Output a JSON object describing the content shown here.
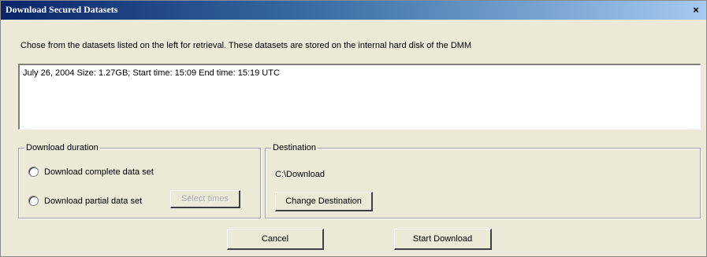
{
  "window": {
    "title": "Download Secured Datasets",
    "close_label": "×"
  },
  "instructions": "Chose from the datasets listed on the left for retrieval.  These datasets are stored on the internal hard disk of the DMM",
  "datasets": [
    "July 26, 2004 Size: 1.27GB; Start time: 15:09 End time: 15:19 UTC"
  ],
  "duration": {
    "legend": "Download duration",
    "complete_label": "Download complete data set",
    "partial_label": "Download partial data set",
    "select_times_label": "Select times"
  },
  "destination": {
    "legend": "Destination",
    "path": "C:\\Download",
    "change_label": "Change Destination"
  },
  "buttons": {
    "cancel": "Cancel",
    "start": "Start Download"
  }
}
